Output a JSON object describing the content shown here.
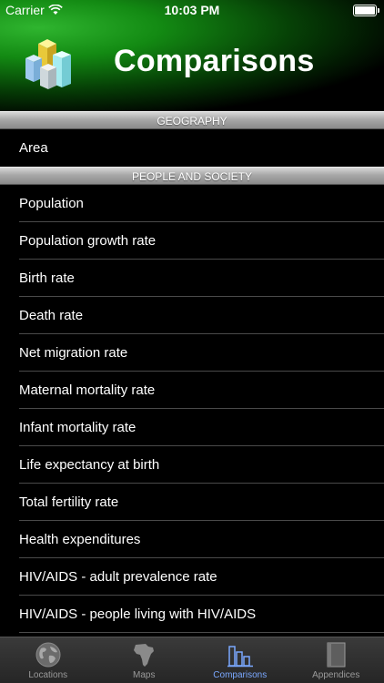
{
  "status": {
    "carrier": "Carrier",
    "time": "10:03 PM"
  },
  "header": {
    "title": "Comparisons",
    "logo_icon": "bar-chart-3d-icon"
  },
  "sections": [
    {
      "title": "GEOGRAPHY",
      "items": [
        "Area"
      ]
    },
    {
      "title": "PEOPLE AND SOCIETY",
      "items": [
        "Population",
        "Population growth rate",
        "Birth rate",
        "Death rate",
        "Net migration rate",
        "Maternal mortality rate",
        "Infant mortality rate",
        "Life expectancy at birth",
        "Total fertility rate",
        "Health expenditures",
        "HIV/AIDS - adult prevalence rate",
        "HIV/AIDS - people living with HIV/AIDS"
      ]
    }
  ],
  "tabbar": {
    "active": "Comparisons",
    "tabs": [
      {
        "label": "Locations",
        "icon": "globe-icon"
      },
      {
        "label": "Maps",
        "icon": "africa-map-icon"
      },
      {
        "label": "Comparisons",
        "icon": "bar-chart-icon"
      },
      {
        "label": "Appendices",
        "icon": "book-icon"
      }
    ]
  },
  "colors": {
    "accent": "#7aa8ff",
    "header_green": "#138a13",
    "background": "#000000"
  }
}
